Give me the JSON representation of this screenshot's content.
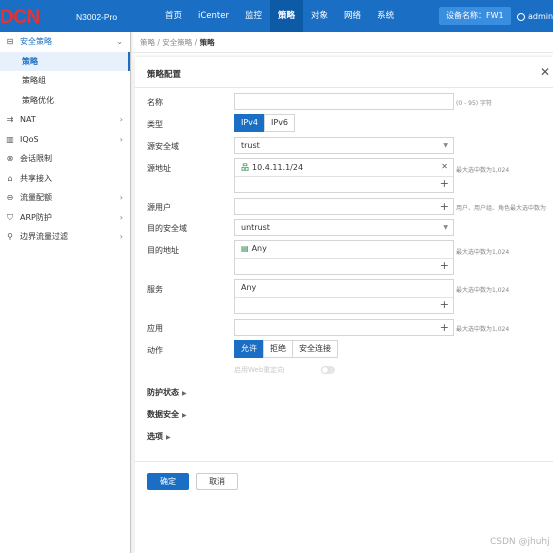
{
  "topbar": {
    "logo": "DCN",
    "model": "N3002-Pro",
    "nav": [
      "首页",
      "iCenter",
      "监控",
      "策略",
      "对象",
      "网络",
      "系统"
    ],
    "active_nav": "策略",
    "device_label": "设备名称：FW1",
    "user": "admin",
    "user_caret": "▾"
  },
  "sidebar": {
    "items": [
      {
        "label": "安全策略",
        "icon": "security-policy-icon",
        "glyph": "⊟",
        "chev": "⌄"
      },
      {
        "label": "策略"
      },
      {
        "label": "策略组"
      },
      {
        "label": "策略优化"
      },
      {
        "label": "NAT",
        "icon": "nat-icon",
        "glyph": "⇉",
        "chev": "›"
      },
      {
        "label": "IQoS",
        "icon": "qos-icon",
        "glyph": "▥",
        "chev": "›"
      },
      {
        "label": "会话限制",
        "icon": "session-limit-icon",
        "glyph": "⊗"
      },
      {
        "label": "共享接入",
        "icon": "shared-access-icon",
        "glyph": "⌂"
      },
      {
        "label": "流量配额",
        "icon": "traffic-quota-icon",
        "glyph": "⊖",
        "chev": "›"
      },
      {
        "label": "ARP防护",
        "icon": "arp-protect-icon",
        "glyph": "⛉",
        "chev": "›"
      },
      {
        "label": "边界流量过滤",
        "icon": "border-filter-icon",
        "glyph": "⚲",
        "chev": "›"
      }
    ]
  },
  "breadcrumb": {
    "part1": "策略",
    "sep1": " / ",
    "part2": "安全策略",
    "sep2": " / ",
    "current": "策略"
  },
  "dialog": {
    "title": "策略配置",
    "close": "✕",
    "labels": {
      "name": "名称",
      "type": "类型",
      "src_zone": "源安全域",
      "src_addr": "源地址",
      "src_user": "源用户",
      "dst_zone": "目的安全域",
      "dst_addr": "目的地址",
      "service": "服务",
      "app": "应用",
      "action": "动作"
    },
    "name_value": "",
    "name_hint": "(0 - 95) 字符",
    "type_options": [
      "IPv4",
      "IPv6"
    ],
    "type_selected": "IPv4",
    "src_zone_value": "trust",
    "src_addr_value": "10.4.11.1/24",
    "src_addr_hint": "最大选中数为1,024",
    "src_user_hint": "用户、用户组、角色最大选中数为",
    "dst_zone_value": "untrust",
    "dst_addr_value": "Any",
    "dst_addr_hint": "最大选中数为1,024",
    "service_value": "Any",
    "service_hint": "最大选中数为1,024",
    "app_hint": "最大选中数为1,024",
    "actions": [
      "允许",
      "拒绝",
      "安全连接"
    ],
    "action_selected": "允许",
    "web_redirect_label": "启用Web重定向",
    "web_redirect_on": false,
    "sections": [
      "防护状态",
      "数据安全",
      "选项"
    ],
    "ok": "确定",
    "cancel": "取消",
    "plus": "+",
    "caret": "▼",
    "remove": "✕",
    "section_caret": "▶",
    "src_addr_glyph": "品",
    "dst_addr_glyph": "▤"
  },
  "watermark": "CSDN @jhuhj"
}
